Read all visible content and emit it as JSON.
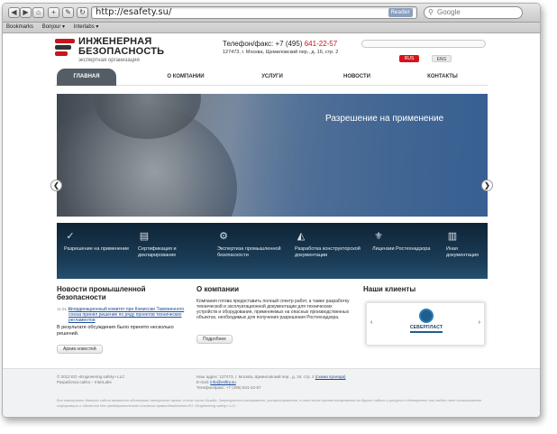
{
  "browser": {
    "nav_buttons": [
      "◀",
      "▶",
      "⌂",
      "+",
      "✎",
      "↻"
    ],
    "url": "http://esafety.su/",
    "reader_label": "Reader",
    "search_placeholder": "Google",
    "bookmarks": [
      "Bookmarks",
      "Bonjour ▾",
      "Interlabs ▾"
    ]
  },
  "header": {
    "logo_line1": "ИНЖЕНЕРНАЯ",
    "logo_line2": "БЕЗОПАСНОСТЬ",
    "logo_subtitle": "экспертная организация",
    "phone_label": "Телефон/факс: +7 (495)",
    "phone_number": "641-22-57",
    "address": "127473, г. Москва, Щемиловский пер., д. 16, стр. 2",
    "lang_rus": "RUS",
    "lang_eng": "ENG",
    "logo_colors": [
      "#c8141c",
      "#333333",
      "#c8141c"
    ]
  },
  "nav": {
    "items": [
      "ГЛАВНАЯ",
      "О КОМПАНИИ",
      "УСЛУГИ",
      "НОВОСТИ",
      "КОНТАКТЫ"
    ],
    "active_color": "#545d66"
  },
  "hero": {
    "caption": "Разрешение на применение",
    "prev_label": "❮",
    "next_label": "❯"
  },
  "services": [
    {
      "icon": "check-icon",
      "glyph": "✓",
      "label": "Разрешение на применение"
    },
    {
      "icon": "document-icon",
      "glyph": "▤",
      "label": "Сертификация и декларирование"
    },
    {
      "icon": "gear-icon",
      "glyph": "⚙",
      "label": "Экспертиза промышленной безопасности"
    },
    {
      "icon": "drafting-icon",
      "glyph": "◭",
      "label": "Разработка конструкторской документации"
    },
    {
      "icon": "emblem-icon",
      "glyph": "⚜",
      "label": "Лицензии Ростехнадзора"
    },
    {
      "icon": "docs-icon",
      "glyph": "▥",
      "label": "Иная документация"
    }
  ],
  "news": {
    "title": "Новости промышленной безопасности",
    "date": "11.01.12",
    "link": "Координационный комитет при Комиссии Таможенного союза принял решение по ряду проектов технических регламентов",
    "text": "В результате обсуждения было принято несколько решений.",
    "archive_button": "Архив новостей"
  },
  "about": {
    "title": "О компании",
    "text": "Компания готова предоставить полный спектр работ, а также разработку технической и эксплуатационной документации для технических устройств и оборудования, применяемых на опасных производственных объектах, необходимых для получения разрешения Ростехнадзора.",
    "more_button": "Подробнее"
  },
  "clients": {
    "title": "Наши клиенты",
    "client_name": "СЕВЕРПЛАСТ",
    "prev": "‹",
    "next": "›"
  },
  "footer": {
    "copyright": "© 2012 ЕО «Engineering safety» LLC",
    "developer": "Разработка сайта – InterLabs",
    "address_line": "Наш адрес: 127473, г. Москва, Щемиловский пер., д. 16, стр. 2",
    "map_link": "(схема проезда)",
    "email_label": "E-mail:",
    "email": "info@esftry.su",
    "phone": "Телефон/факс: +7 (495) 641-22-57",
    "legal": "Все материалы данного сайта являются объектами авторского права, в том числе дизайн. Запрещается копирование, распространение, в том числе путем копирования на другие сайты и ресурсы в Интернете или любое иное использование информации и объектов без предварительного согласия правообладателя ЕО «Engineering safety» LLC."
  }
}
